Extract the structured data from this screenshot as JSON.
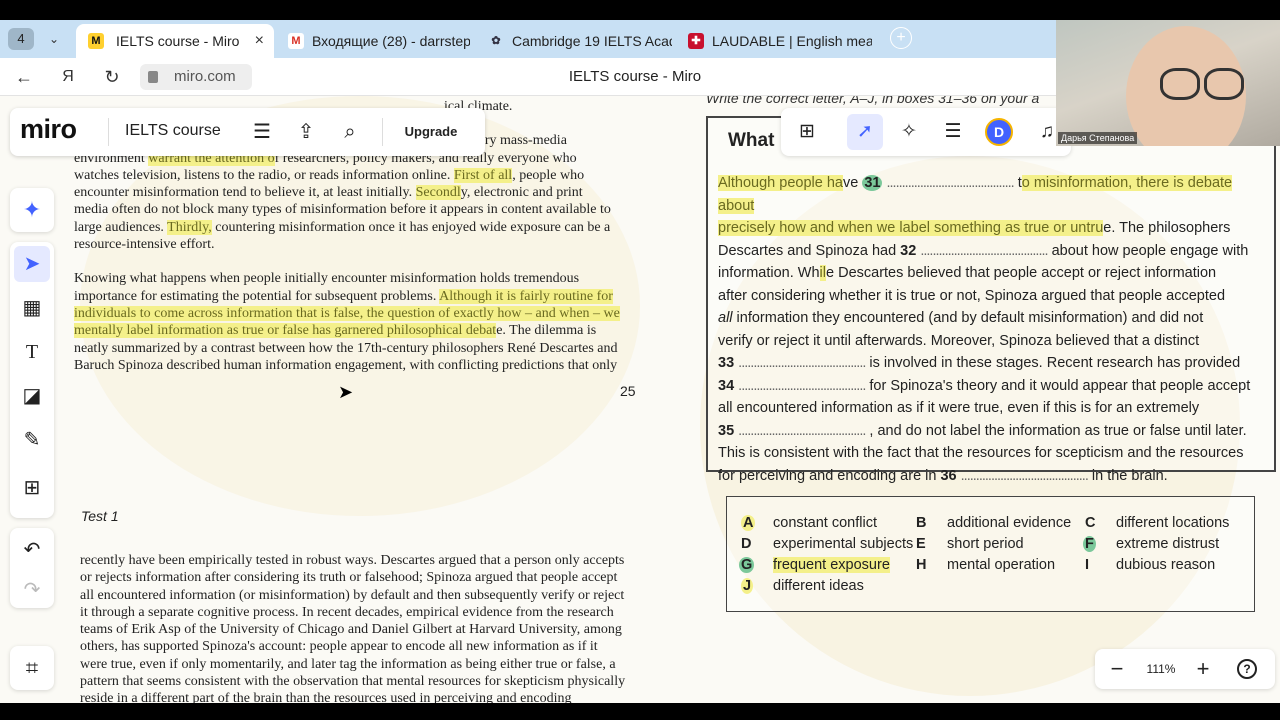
{
  "browser": {
    "tab_count": "4",
    "tabs": [
      {
        "title": "IELTS course - Miro",
        "favicon": "miro-icon"
      },
      {
        "title": "Входящие (28) - darrstepa",
        "favicon": "gmail-icon"
      },
      {
        "title": "Cambridge 19 IELTS Acade",
        "favicon": "cambridge-icon"
      },
      {
        "title": "LAUDABLE | English mean",
        "favicon": "cambridge-dictionary-icon"
      }
    ],
    "close_label": "×",
    "new_tab_label": "+",
    "url": "miro.com",
    "page_title": "IELTS course - Miro"
  },
  "miro": {
    "logo": "miro",
    "board_name": "IELTS course",
    "upgrade_label": "Upgrade",
    "zoom_level": "111%",
    "zoom_out_label": "−",
    "zoom_in_label": "+",
    "help_label": "?",
    "avatar_initial": "D",
    "accent": "#4262ff"
  },
  "webcam": {
    "name": "Дарья Степанова"
  },
  "left_doc": {
    "top_partial": "ical climate.",
    "para1_l1_a": "rary mass-media",
    "para1_l2_a": "environment ",
    "para1_l2_hl": "warrant the attention o",
    "para1_l2_b": "f researchers, policy makers, and really everyone who",
    "para1_l3_a": "watches television, listens to the radio, or reads information online. ",
    "para1_l3_hl": "First of all",
    "para1_l3_b": ", people who",
    "para1_l4_a": "encounter misinformation tend to believe it, at least initially. ",
    "para1_l4_hl": "Secondl",
    "para1_l4_b": "y, electronic and print",
    "para1_l5": "media often do not block many types of misinformation before it appears in content available to",
    "para1_l6_a": "large audiences. ",
    "para1_l6_hl": "Thirdly,",
    "para1_l6_b": " countering misinformation once it has enjoyed wide exposure can be a",
    "para1_l7": "resource-intensive effort.",
    "para2_l1": "Knowing what happens when people initially encounter misinformation holds tremendous",
    "para2_l2_a": "importance for estimating the potential for subsequent problems. ",
    "para2_l2_hl": "Although it is fairly routine for",
    "para2_l3_hl": "individuals to come across information that is false, the question of exactly how – and when – we",
    "para2_l4_hl": "mentally label information as true or false has garnered philosophical debat",
    "para2_l4_b": "e. The dilemma is",
    "para2_l5": "neatly summarized by a contrast between how the 17th-century philosophers René Descartes and",
    "para2_l6": "Baruch Spinoza described human information engagement, with conflicting predictions that only",
    "page_number": "25",
    "test_label": "Test 1",
    "para3": [
      "recently have been empirically tested in robust ways. Descartes argued that a person only accepts",
      "or rejects information after considering its truth or falsehood; Spinoza argued that people accept",
      "all encountered information (or misinformation) by default and then subsequently verify or reject",
      "it through a separate cognitive process. In recent decades, empirical evidence from the research",
      "teams of Erik Asp of the University of Chicago and Daniel Gilbert at Harvard University, among",
      "others, has supported Spinoza's account: people appear to encode all new information as if it",
      "were true, even if only momentarily, and later tag the information as being either true or false, a",
      "pattern that seems consistent with the observation that mental resources for skepticism physically",
      "reside in a different part of the brain than the resources used in perceiving and encoding"
    ]
  },
  "right_doc": {
    "instruction": "Write the correct letter, A–J, in boxes 31–36 on your a",
    "summary_title": "What",
    "summary_title_tail": "e",
    "s1_hl": "Although people ha",
    "s1_b": "ve ",
    "q31": "31",
    "q32": "32",
    "q33": "33",
    "q34": "34",
    "q35": "35",
    "q36": "36",
    "dots": "..........................................",
    "s1_c": " t",
    "s1_hl2": "o misinformation, there is debate about",
    "s2_hl": "precisely how and when we label something as true or untru",
    "s2_b": "e. The philosophers",
    "s3": "Descartes and Spinoza had ",
    "s3_b": " about how people engage with",
    "s4_a": "information. Wh",
    "s4_hl": "il",
    "s4_b": "e Descartes believed that people accept or reject information",
    "s5": "after considering whether it is true or not, Spinoza argued that people accepted",
    "s6_it": "all",
    "s6": " information they encountered (and by default misinformation) and did not",
    "s7": "verify or reject it until afterwards. Moreover, Spinoza believed that a distinct",
    "s8": " is involved in these stages. Recent research has provided",
    "s9": " for Spinoza's theory and it would appear that people accept",
    "s10": "all encountered information as if it were true, even if this is for an extremely",
    "s11": " , and do not label the information as true or false until later.",
    "s12": "This is consistent with the fact that the resources for scepticism and the resources",
    "s13": "for perceiving and encoding are in ",
    "s13_b": " in the brain."
  },
  "options": [
    {
      "letter": "A",
      "text": "constant conflict",
      "mark": "yellow"
    },
    {
      "letter": "B",
      "text": "additional evidence",
      "mark": "none"
    },
    {
      "letter": "C",
      "text": "different locations",
      "mark": "none"
    },
    {
      "letter": "D",
      "text": "experimental subjects",
      "mark": "none"
    },
    {
      "letter": "E",
      "text": "short period",
      "mark": "none"
    },
    {
      "letter": "F",
      "text": "extreme distrust",
      "mark": "green"
    },
    {
      "letter": "G",
      "text": "frequent exposure",
      "mark": "green"
    },
    {
      "letter": "H",
      "text": "mental operation",
      "mark": "none"
    },
    {
      "letter": "I",
      "text": "dubious reason",
      "mark": "none"
    },
    {
      "letter": "J",
      "text": "different ideas",
      "mark": "yellow"
    }
  ]
}
